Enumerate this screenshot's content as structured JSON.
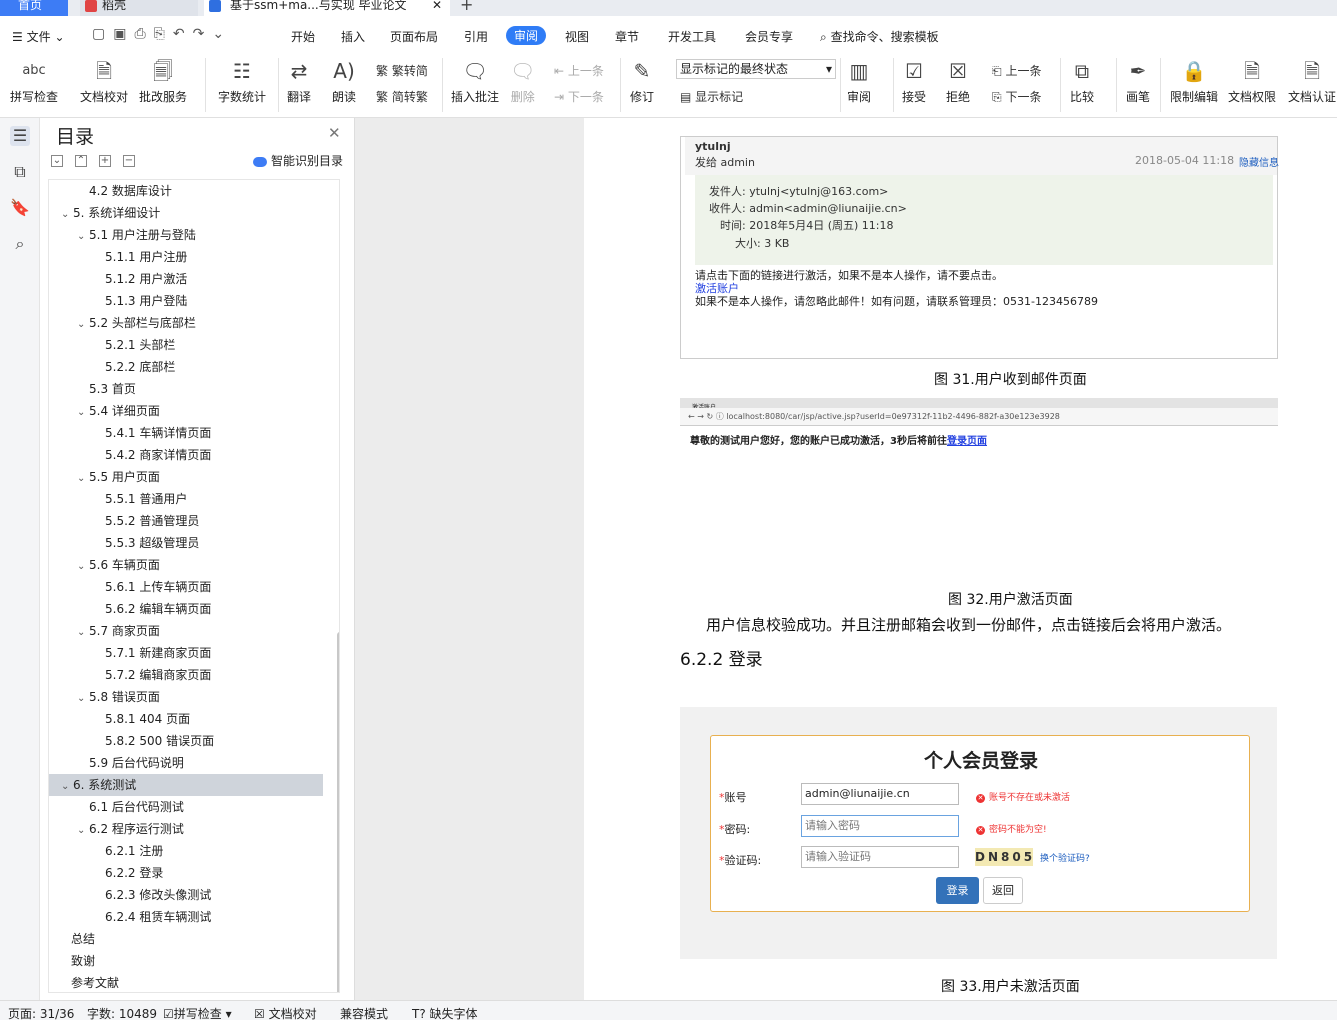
{
  "tabs": [
    {
      "label": "首页"
    },
    {
      "label": "稻壳"
    },
    {
      "label": "基于ssm+ma...与实现 毕业论文"
    }
  ],
  "menu": {
    "file": "文件",
    "items": [
      "开始",
      "插入",
      "页面布局",
      "引用",
      "审阅",
      "视图",
      "章节",
      "开发工具",
      "会员专享"
    ],
    "active": "审阅",
    "search": "查找命令、搜索模板"
  },
  "ribbon": {
    "spell": "拼写检查",
    "proof": "文档校对",
    "annotate_service": "批改服务",
    "wordcount": "字数统计",
    "translate": "翻译",
    "read": "朗读",
    "trad_to_simp": "繁转简",
    "simp_to_trad": "简转繁",
    "insert_comment": "插入批注",
    "delete": "删除",
    "prev": "上一条",
    "next": "下一条",
    "track": "修订",
    "markup_state": "显示标记的最终状态",
    "show_markup": "显示标记",
    "review": "审阅",
    "accept": "接受",
    "reject": "拒绝",
    "prev2": "上一条",
    "next2": "下一条",
    "compare": "比较",
    "pen": "画笔",
    "restrict": "限制编辑",
    "permission": "文档权限",
    "certify": "文档认证"
  },
  "toc": {
    "title": "目录",
    "ai": "智能识别目录",
    "items": [
      {
        "t": "4.2  数据库设计",
        "lvl": 2,
        "c": false
      },
      {
        "t": "5.  系统详细设计",
        "lvl": 1,
        "c": true
      },
      {
        "t": "5.1  用户注册与登陆",
        "lvl": 2,
        "c": true
      },
      {
        "t": "5.1.1  用户注册",
        "lvl": 3,
        "c": false
      },
      {
        "t": "5.1.2  用户激活",
        "lvl": 3,
        "c": false
      },
      {
        "t": "5.1.3  用户登陆",
        "lvl": 3,
        "c": false
      },
      {
        "t": "5.2  头部栏与底部栏",
        "lvl": 2,
        "c": true
      },
      {
        "t": "5.2.1  头部栏",
        "lvl": 3,
        "c": false
      },
      {
        "t": "5.2.2  底部栏",
        "lvl": 3,
        "c": false
      },
      {
        "t": "5.3  首页",
        "lvl": 2,
        "c": false
      },
      {
        "t": "5.4  详细页面",
        "lvl": 2,
        "c": true
      },
      {
        "t": "5.4.1  车辆详情页面",
        "lvl": 3,
        "c": false
      },
      {
        "t": "5.4.2  商家详情页面",
        "lvl": 3,
        "c": false
      },
      {
        "t": "5.5  用户页面",
        "lvl": 2,
        "c": true
      },
      {
        "t": "5.5.1  普通用户",
        "lvl": 3,
        "c": false
      },
      {
        "t": "5.5.2  普通管理员",
        "lvl": 3,
        "c": false
      },
      {
        "t": "5.5.3  超级管理员",
        "lvl": 3,
        "c": false
      },
      {
        "t": "5.6  车辆页面",
        "lvl": 2,
        "c": true
      },
      {
        "t": "5.6.1  上传车辆页面",
        "lvl": 3,
        "c": false
      },
      {
        "t": "5.6.2  编辑车辆页面",
        "lvl": 3,
        "c": false
      },
      {
        "t": "5.7  商家页面",
        "lvl": 2,
        "c": true
      },
      {
        "t": "5.7.1  新建商家页面",
        "lvl": 3,
        "c": false
      },
      {
        "t": "5.7.2  编辑商家页面",
        "lvl": 3,
        "c": false
      },
      {
        "t": "5.8  错误页面",
        "lvl": 2,
        "c": true
      },
      {
        "t": "5.8.1  404 页面",
        "lvl": 3,
        "c": false
      },
      {
        "t": "5.8.2  500 错误页面",
        "lvl": 3,
        "c": false
      },
      {
        "t": "5.9  后台代码说明",
        "lvl": 2,
        "c": false
      },
      {
        "t": "6.  系统测试",
        "lvl": 1,
        "c": true,
        "sel": true
      },
      {
        "t": "6.1  后台代码测试",
        "lvl": 2,
        "c": false
      },
      {
        "t": "6.2  程序运行测试",
        "lvl": 2,
        "c": true
      },
      {
        "t": "6.2.1  注册",
        "lvl": 3,
        "c": false
      },
      {
        "t": "6.2.2  登录",
        "lvl": 3,
        "c": false
      },
      {
        "t": "6.2.3  修改头像测试",
        "lvl": 3,
        "c": false
      },
      {
        "t": "6.2.4  租赁车辆测试",
        "lvl": 3,
        "c": false
      },
      {
        "t": "总结",
        "lvl": 0,
        "c": false
      },
      {
        "t": "致谢",
        "lvl": 0,
        "c": false
      },
      {
        "t": "参考文献",
        "lvl": 0,
        "c": false
      }
    ]
  },
  "doc": {
    "mail": {
      "sender": "ytulnj",
      "to_line": "发给 admin",
      "date": "2018-05-04 11:18",
      "hide": "隐藏信息",
      "from": "发件人: ytulnj<ytulnj@163.com>",
      "recv": "收件人: admin<admin@liunaijie.cn>",
      "time": "时间: 2018年5月4日 (周五) 11:18",
      "size": "大小: 3 KB",
      "body1": "请点击下面的链接进行激活，如果不是本人操作，请不要点击。",
      "link": "激活账户",
      "body2": "如果不是本人操作，请忽略此邮件！如有问题，请联系管理员：0531-123456789"
    },
    "cap31": "图 31.用户收到邮件页面",
    "browser": {
      "tab": "激活账户",
      "url": "localhost:8080/car/jsp/active.jsp?userId=0e97312f-11b2-4496-882f-a30e123e3928",
      "msg": "尊敬的测试用户您好，您的账户已成功激活，3秒后将前往",
      "msg_link": "登录页面"
    },
    "cap32": "图 32.用户激活页面",
    "para": "用户信息校验成功。并且注册邮箱会收到一份邮件，点击链接后会将用户激活。",
    "heading": "6.2.2  登录",
    "login": {
      "title": "个人会员登录",
      "acc_lbl": "账号",
      "acc_val": "admin@liunaijie.cn",
      "acc_err": "账号不存在或未激活",
      "pwd_lbl": "密码:",
      "pwd_ph": "请输入密码",
      "pwd_err": "密码不能为空!",
      "code_lbl": "验证码:",
      "code_ph": "请输入验证码",
      "captcha": "DN805",
      "change": "换个验证码?",
      "login_btn": "登录",
      "back_btn": "返回"
    },
    "cap33": "图 33.用户未激活页面"
  },
  "status": {
    "page": "页面: 31/36",
    "words": "字数: 10489",
    "spell": "拼写检查",
    "proof": "文档校对",
    "compat": "兼容模式",
    "font": "缺失字体"
  }
}
